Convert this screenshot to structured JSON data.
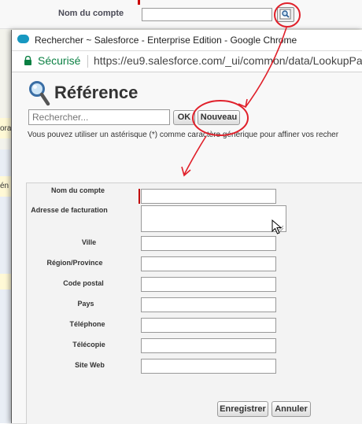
{
  "background_page": {
    "account_name_label": "Nom du compte",
    "side_fragment_1": "ora",
    "side_fragment_2": "én"
  },
  "window": {
    "title": "Rechercher ~ Salesforce - Enterprise Edition - Google Chrome",
    "secure_label": "Sécurisé",
    "url": "https://eu9.salesforce.com/_ui/common/data/LookupPa"
  },
  "lookup": {
    "title": "Référence",
    "search_placeholder": "Rechercher...",
    "ok_label": "OK",
    "new_label": "Nouveau",
    "hint": "Vous pouvez utiliser un astérisque (*) comme caractère générique pour affiner vos recher"
  },
  "form": {
    "fields": [
      {
        "label": "Nom du compte",
        "value": "",
        "required": true
      },
      {
        "label": "Adresse de facturation",
        "value": ""
      },
      {
        "label": "Ville",
        "value": ""
      },
      {
        "label": "Région/Province",
        "value": ""
      },
      {
        "label": "Code postal",
        "value": ""
      },
      {
        "label": "Pays",
        "value": ""
      },
      {
        "label": "Téléphone",
        "value": ""
      },
      {
        "label": "Télécopie",
        "value": ""
      },
      {
        "label": "Site Web",
        "value": ""
      }
    ],
    "save_label": "Enregistrer",
    "cancel_label": "Annuler"
  },
  "colors": {
    "annotation": "#e0202a",
    "salesforce_blue": "#1798c1",
    "secure_green": "#0b8043",
    "required": "#c00000"
  },
  "icons": [
    "lookup-icon",
    "salesforce-cloud-icon",
    "lock-icon",
    "magnifier-icon",
    "resize-grip-icon",
    "mouse-cursor-icon"
  ]
}
